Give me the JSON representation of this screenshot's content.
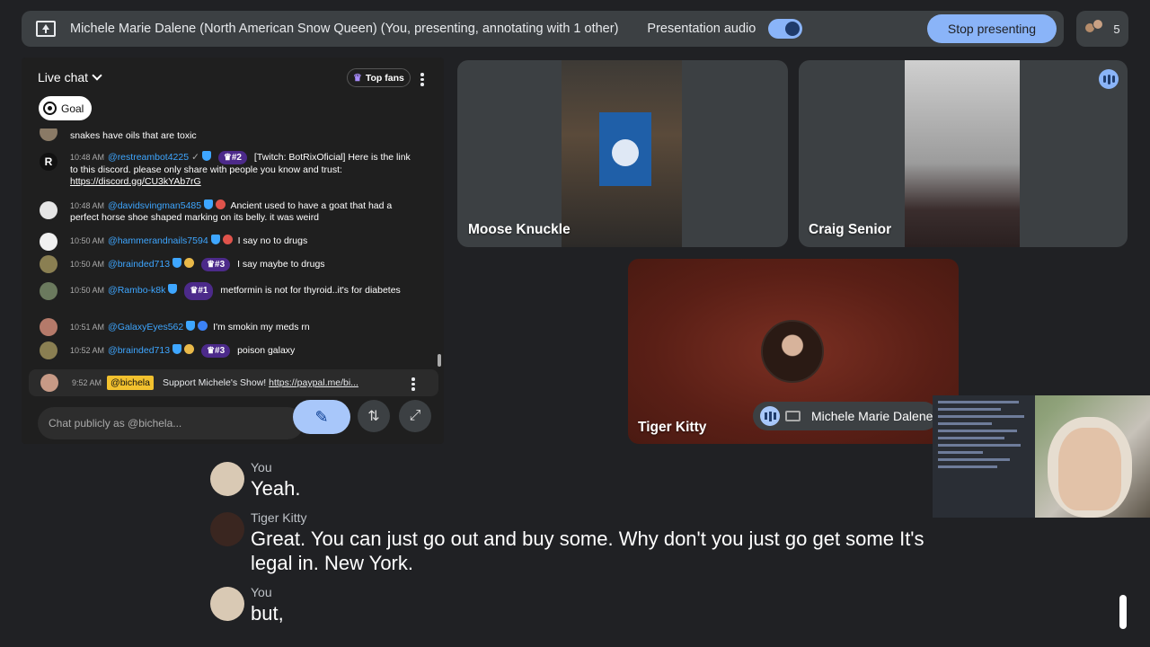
{
  "topbar": {
    "title": "Michele Marie Dalene (North American Snow Queen) (You, presenting, annotating with 1 other)",
    "audio_label": "Presentation audio",
    "stop_label": "Stop presenting",
    "people_count": "5"
  },
  "chat": {
    "title": "Live chat",
    "top_fans": "Top fans",
    "goal": "Goal",
    "messages": [
      {
        "time": "",
        "user": "",
        "text": "snakes have oils that are toxic",
        "rank": ""
      },
      {
        "time": "10:48 AM",
        "user": "@restreambot4225",
        "rank": "#2",
        "text": "[Twitch: BotRixOficial] Here is the link to this discord. please only share with people you know and trust:",
        "link": "https://discord.gg/CU3kYAb7rG"
      },
      {
        "time": "10:48 AM",
        "user": "@davidsvingman5485",
        "rank": "",
        "text": "Ancient used to have a goat that had a perfect horse shoe shaped marking on its belly. it was weird"
      },
      {
        "time": "10:50 AM",
        "user": "@hammerandnails7594",
        "rank": "",
        "text": "I say no to drugs"
      },
      {
        "time": "10:50 AM",
        "user": "@brainded713",
        "rank": "#3",
        "text": "I say maybe to drugs"
      },
      {
        "time": "10:50 AM",
        "user": "@Rambo-k8k",
        "rank": "#1",
        "text": "metformin is not for thyroid..it's for diabetes"
      },
      {
        "time": "10:51 AM",
        "user": "@GalaxyEyes562",
        "rank": "",
        "text": "I'm smokin my meds rn"
      },
      {
        "time": "10:52 AM",
        "user": "@brainded713",
        "rank": "#3",
        "text": "poison galaxy"
      }
    ],
    "pinned": {
      "time": "9:52 AM",
      "user": "@bichela",
      "text": "Support Michele's Show!",
      "link": "https://paypal.me/bi..."
    },
    "input_placeholder": "Chat publicly as @bichela..."
  },
  "tiles": {
    "moose": "Moose Knuckle",
    "craig": "Craig Senior",
    "tiger": "Tiger Kitty",
    "self": "Michele Marie Dalene"
  },
  "captions": [
    {
      "speaker": "You",
      "text": "Yeah."
    },
    {
      "speaker": "Tiger Kitty",
      "text": "Great. You can just go out and buy some. Why don't you just go get some It's legal in. New York."
    },
    {
      "speaker": "You",
      "text": "but,"
    }
  ],
  "colors": {
    "accent": "#8ab4f8",
    "surface": "#3c4043",
    "background": "#202124",
    "pin_highlight": "#f2c12e"
  }
}
